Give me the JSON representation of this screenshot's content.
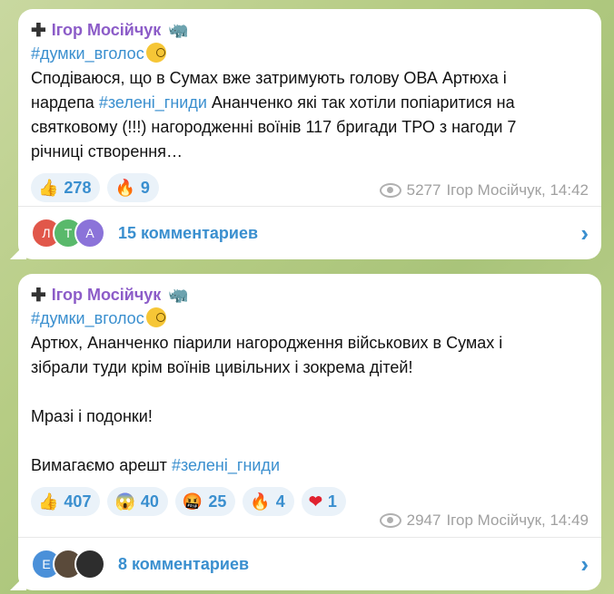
{
  "posts": [
    {
      "author": "Ігор Мосійчук",
      "hashtag": "#думки_вголос",
      "lines": [
        "Сподіваюся, що в Сумах вже затримують голову ОВА Артюха і",
        "нардепа",
        "Ананченко які так хотіли попіаритися на",
        "святковому (!!!) нагородженні воїнів 117 бригади ТРО з нагоди 7",
        "річниці створення…"
      ],
      "inline_tag": "#зелені_гниди",
      "reactions": [
        {
          "emoji": "👍",
          "count": "278"
        },
        {
          "emoji": "🔥",
          "count": "9"
        }
      ],
      "views": "5277",
      "signature": "Ігор Мосійчук, 14:42",
      "avatars": [
        {
          "letter": "Л",
          "color": "#e1574a"
        },
        {
          "letter": "Т",
          "color": "#59b96b"
        },
        {
          "letter": "А",
          "color": "#8b73d9"
        }
      ],
      "comments": "15 комментариев"
    },
    {
      "author": "Ігор Мосійчук",
      "hashtag": "#думки_вголос",
      "lines": [
        "Артюх, Ананченко піарили нагородження військових в Сумах і",
        "зібрали туди крім воїнів цивільних і зокрема дітей!",
        "Мразі і подонки!",
        "Вимагаємо арешт"
      ],
      "inline_tag": "#зелені_гниди",
      "reactions": [
        {
          "emoji": "👍",
          "count": "407"
        },
        {
          "emoji": "😱",
          "count": "40"
        },
        {
          "emoji": "🤬",
          "count": "25"
        },
        {
          "emoji": "🔥",
          "count": "4"
        },
        {
          "emoji": "❤",
          "count": "1"
        }
      ],
      "views": "2947",
      "signature": "Ігор Мосійчук, 14:49",
      "avatars": [
        {
          "letter": "Е",
          "color": "#4a90d9"
        },
        {
          "letter": "",
          "color": "#5a4a3a"
        },
        {
          "letter": "",
          "color": "#2d2d2d"
        }
      ],
      "comments": "8 комментариев"
    }
  ]
}
